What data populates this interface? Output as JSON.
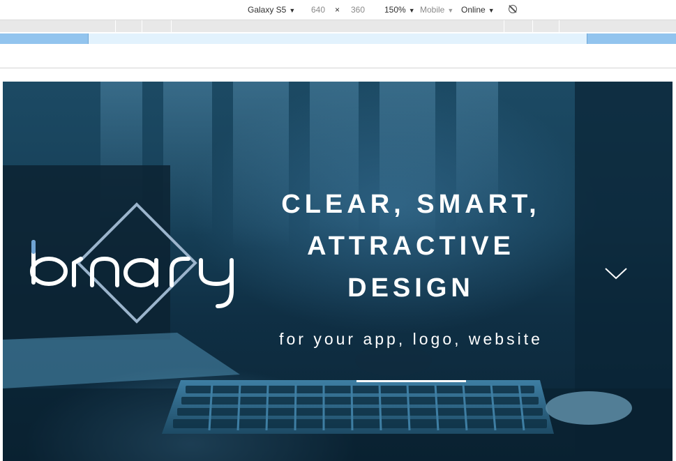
{
  "toolbar": {
    "device": "Galaxy S5",
    "width": "640",
    "times": "×",
    "height": "360",
    "zoom": "150%",
    "mode": "Mobile",
    "network": "Online",
    "rotate_icon": "rotate-icon"
  },
  "hero": {
    "logo_text": "binary",
    "headline_line1": "CLEAR, SMART,",
    "headline_line2": "ATTRACTIVE",
    "headline_line3": "DESIGN",
    "tagline": "for your app, logo, website",
    "scroll_icon": "chevron-down-icon"
  },
  "colors": {
    "hero_bg": "#163f57",
    "text": "#ffffff",
    "media_query_blue": "#92c4ee",
    "media_query_light": "#e2f2fd"
  }
}
